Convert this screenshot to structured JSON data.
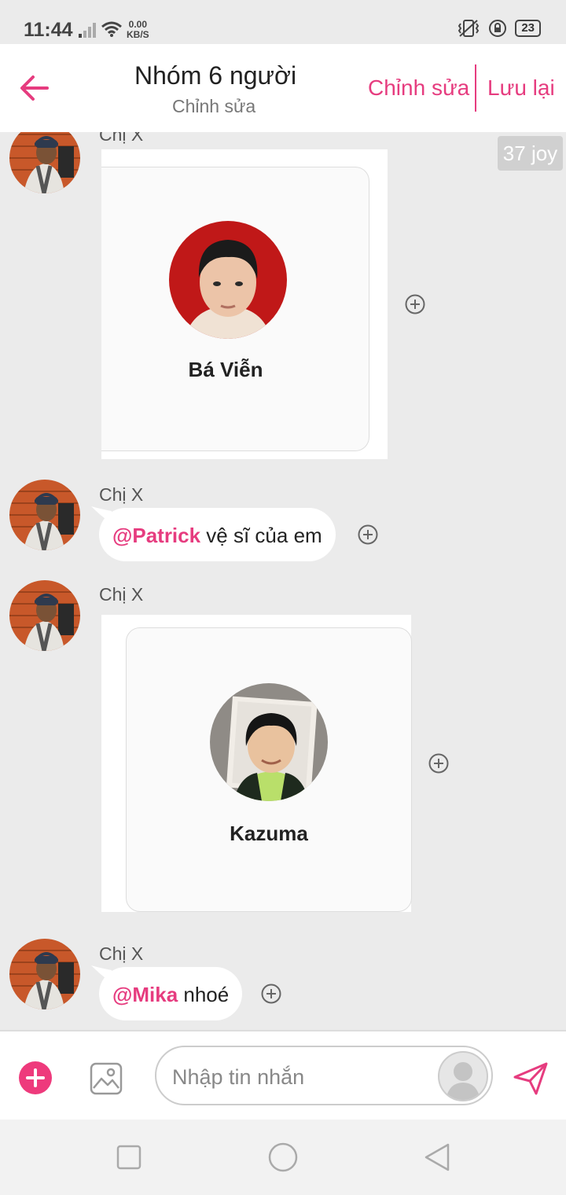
{
  "status_bar": {
    "time": "11:44",
    "speed_value": "0.00",
    "speed_unit": "KB/S",
    "battery": "23"
  },
  "header": {
    "title": "Nhóm 6 người",
    "subtitle": "Chỉnh sửa",
    "edit_label": "Chỉnh sửa",
    "save_label": "Lưu lại",
    "accent_color": "#e63c7f"
  },
  "messages": [
    {
      "sender": "Chị X",
      "type": "contact_card",
      "contact_name": "Bá Viễn"
    },
    {
      "sender": "Chị X",
      "type": "text",
      "mention": "@Patrick",
      "text": " vệ sĩ của em"
    },
    {
      "sender": "Chị X",
      "type": "contact_card",
      "contact_name": "Kazuma"
    },
    {
      "sender": "Chị X",
      "type": "text",
      "mention": "@Mika",
      "text": " nhoé"
    }
  ],
  "joy_badge": "37 joy",
  "composer": {
    "placeholder": "Nhập tin nhắn",
    "value": ""
  },
  "icons": [
    "back-arrow-icon",
    "plus-circle-icon",
    "image-icon",
    "send-icon",
    "add-icon",
    "recent-apps-icon",
    "home-icon",
    "back-nav-icon"
  ]
}
